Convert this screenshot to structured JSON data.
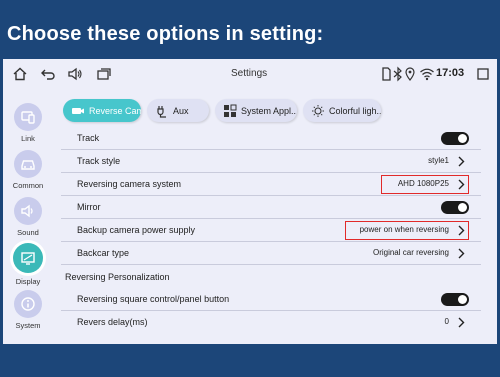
{
  "banner": {
    "title": "Choose these options in setting:"
  },
  "statusbar": {
    "title": "Settings",
    "time": "17:03",
    "icons": [
      "home-icon",
      "back-icon",
      "volume-icon",
      "window-icon",
      "sim-icon",
      "bluetooth-icon",
      "wifi-icon",
      "location-icon"
    ]
  },
  "sidebar": {
    "items": [
      {
        "label": "Link",
        "icon": "link-icon"
      },
      {
        "label": "Common",
        "icon": "car-icon"
      },
      {
        "label": "Sound",
        "icon": "speaker-icon"
      },
      {
        "label": "Display",
        "icon": "display-icon",
        "active": true
      },
      {
        "label": "System",
        "icon": "info-icon"
      }
    ]
  },
  "tabs": [
    {
      "label": "Reverse Cam",
      "active": true
    },
    {
      "label": "Aux"
    },
    {
      "label": "System Appl..."
    },
    {
      "label": "Colorful ligh..."
    }
  ],
  "rows": {
    "track": {
      "label": "Track",
      "toggle": "on"
    },
    "track_style": {
      "label": "Track style",
      "value": "style1"
    },
    "reversing_camera_system": {
      "label": "Reversing camera system",
      "value": "AHD 1080P25",
      "highlighted": true
    },
    "mirror": {
      "label": "Mirror",
      "toggle": "on"
    },
    "backup_power": {
      "label": "Backup camera power supply",
      "value": "power on when reversing",
      "highlighted": true
    },
    "backcar_type": {
      "label": "Backcar type",
      "value": "Original car reversing"
    },
    "section_personalization": {
      "label": "Reversing Personalization"
    },
    "square_control": {
      "label": "Reversing square control/panel button",
      "toggle": "on"
    },
    "revers_delay": {
      "label": "Revers delay(ms)",
      "value": "0"
    }
  },
  "colors": {
    "banner": "#1c4679",
    "accent": "#47c6cc",
    "highlight": "#e12a2a",
    "screen": "#edeef9"
  }
}
